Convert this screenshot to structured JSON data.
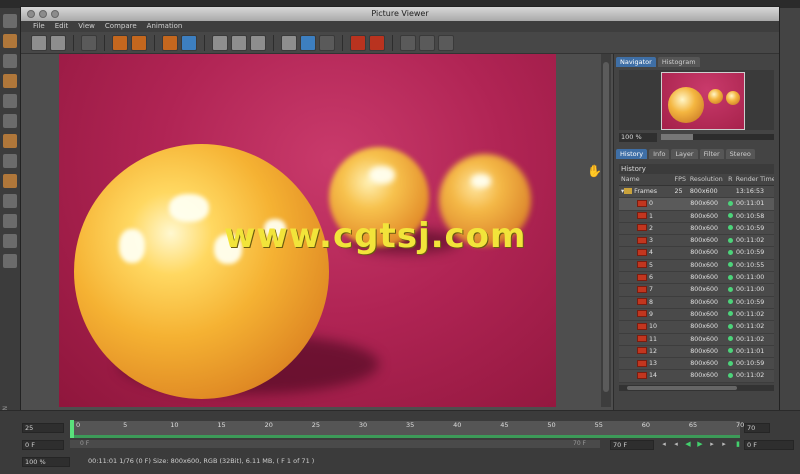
{
  "window": {
    "title": "Picture Viewer"
  },
  "menu": [
    "File",
    "Edit",
    "View",
    "Compare",
    "Animation"
  ],
  "watermark": "www.cgtsj.com",
  "panel": {
    "top_tabs": [
      "Navigator",
      "Histogram"
    ],
    "zoom": "100 %",
    "bottom_tabs": [
      "History",
      "Info",
      "Layer",
      "Filter",
      "Stereo"
    ],
    "history_title": "History",
    "columns": [
      "Name",
      "FPS",
      "Resolution",
      "R",
      "Render Time"
    ],
    "folder": {
      "name": "Frames",
      "fps": "25",
      "resolution": "800x600",
      "time": "13:16:53"
    },
    "rows": [
      {
        "name": "0",
        "resolution": "800x600",
        "time": "00:11:01"
      },
      {
        "name": "1",
        "resolution": "800x600",
        "time": "00:10:58"
      },
      {
        "name": "2",
        "resolution": "800x600",
        "time": "00:10:59"
      },
      {
        "name": "3",
        "resolution": "800x600",
        "time": "00:11:02"
      },
      {
        "name": "4",
        "resolution": "800x600",
        "time": "00:10:59"
      },
      {
        "name": "5",
        "resolution": "800x600",
        "time": "00:10:55"
      },
      {
        "name": "6",
        "resolution": "800x600",
        "time": "00:11:00"
      },
      {
        "name": "7",
        "resolution": "800x600",
        "time": "00:11:00"
      },
      {
        "name": "8",
        "resolution": "800x600",
        "time": "00:10:59"
      },
      {
        "name": "9",
        "resolution": "800x600",
        "time": "00:11:02"
      },
      {
        "name": "10",
        "resolution": "800x600",
        "time": "00:11:02"
      },
      {
        "name": "11",
        "resolution": "800x600",
        "time": "00:11:02"
      },
      {
        "name": "12",
        "resolution": "800x600",
        "time": "00:11:01"
      },
      {
        "name": "13",
        "resolution": "800x600",
        "time": "00:10:59"
      },
      {
        "name": "14",
        "resolution": "800x600",
        "time": "00:11:02"
      }
    ]
  },
  "timeline": {
    "start_field": "25",
    "frame_field": "0 F",
    "zoom_field": "100 %",
    "end_field": "70",
    "current_frame_right": "0 F",
    "end_frame": "70 F",
    "scrub_start": "0 F",
    "scrub_end": "70 F",
    "ticks": [
      "0",
      "5",
      "10",
      "15",
      "20",
      "25",
      "30",
      "35",
      "40",
      "45",
      "50",
      "55",
      "60",
      "65",
      "70"
    ],
    "status": "00:11:01  1/76 (0 F)    Size: 800x600, RGB (32Bit), 6.11 MB,  ( F 1 of 71 )"
  }
}
